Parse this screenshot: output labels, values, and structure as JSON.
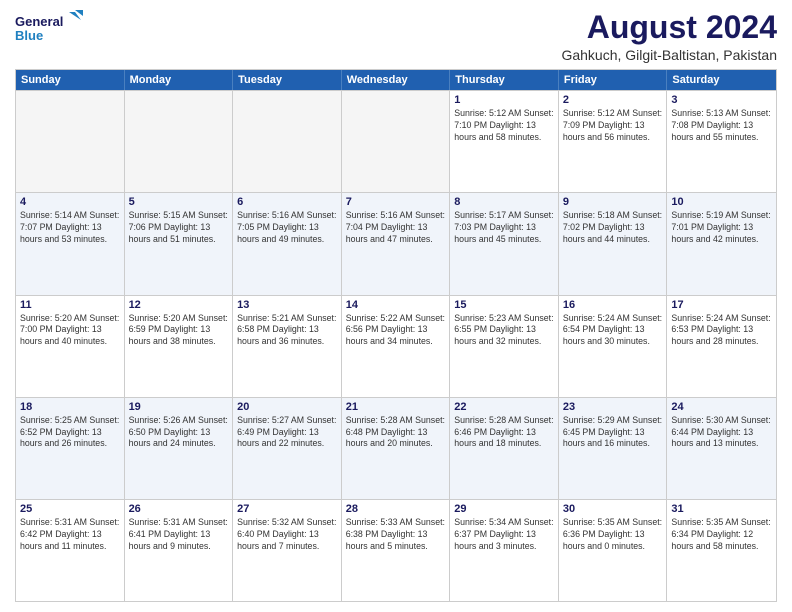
{
  "header": {
    "logo_line1": "General",
    "logo_line2": "Blue",
    "title": "August 2024",
    "subtitle": "Gahkuch, Gilgit-Baltistan, Pakistan"
  },
  "calendar": {
    "days_of_week": [
      "Sunday",
      "Monday",
      "Tuesday",
      "Wednesday",
      "Thursday",
      "Friday",
      "Saturday"
    ],
    "weeks": [
      [
        {
          "day": "",
          "info": "",
          "empty": true
        },
        {
          "day": "",
          "info": "",
          "empty": true
        },
        {
          "day": "",
          "info": "",
          "empty": true
        },
        {
          "day": "",
          "info": "",
          "empty": true
        },
        {
          "day": "1",
          "info": "Sunrise: 5:12 AM\nSunset: 7:10 PM\nDaylight: 13 hours\nand 58 minutes."
        },
        {
          "day": "2",
          "info": "Sunrise: 5:12 AM\nSunset: 7:09 PM\nDaylight: 13 hours\nand 56 minutes."
        },
        {
          "day": "3",
          "info": "Sunrise: 5:13 AM\nSunset: 7:08 PM\nDaylight: 13 hours\nand 55 minutes."
        }
      ],
      [
        {
          "day": "4",
          "info": "Sunrise: 5:14 AM\nSunset: 7:07 PM\nDaylight: 13 hours\nand 53 minutes."
        },
        {
          "day": "5",
          "info": "Sunrise: 5:15 AM\nSunset: 7:06 PM\nDaylight: 13 hours\nand 51 minutes."
        },
        {
          "day": "6",
          "info": "Sunrise: 5:16 AM\nSunset: 7:05 PM\nDaylight: 13 hours\nand 49 minutes."
        },
        {
          "day": "7",
          "info": "Sunrise: 5:16 AM\nSunset: 7:04 PM\nDaylight: 13 hours\nand 47 minutes."
        },
        {
          "day": "8",
          "info": "Sunrise: 5:17 AM\nSunset: 7:03 PM\nDaylight: 13 hours\nand 45 minutes."
        },
        {
          "day": "9",
          "info": "Sunrise: 5:18 AM\nSunset: 7:02 PM\nDaylight: 13 hours\nand 44 minutes."
        },
        {
          "day": "10",
          "info": "Sunrise: 5:19 AM\nSunset: 7:01 PM\nDaylight: 13 hours\nand 42 minutes."
        }
      ],
      [
        {
          "day": "11",
          "info": "Sunrise: 5:20 AM\nSunset: 7:00 PM\nDaylight: 13 hours\nand 40 minutes."
        },
        {
          "day": "12",
          "info": "Sunrise: 5:20 AM\nSunset: 6:59 PM\nDaylight: 13 hours\nand 38 minutes."
        },
        {
          "day": "13",
          "info": "Sunrise: 5:21 AM\nSunset: 6:58 PM\nDaylight: 13 hours\nand 36 minutes."
        },
        {
          "day": "14",
          "info": "Sunrise: 5:22 AM\nSunset: 6:56 PM\nDaylight: 13 hours\nand 34 minutes."
        },
        {
          "day": "15",
          "info": "Sunrise: 5:23 AM\nSunset: 6:55 PM\nDaylight: 13 hours\nand 32 minutes."
        },
        {
          "day": "16",
          "info": "Sunrise: 5:24 AM\nSunset: 6:54 PM\nDaylight: 13 hours\nand 30 minutes."
        },
        {
          "day": "17",
          "info": "Sunrise: 5:24 AM\nSunset: 6:53 PM\nDaylight: 13 hours\nand 28 minutes."
        }
      ],
      [
        {
          "day": "18",
          "info": "Sunrise: 5:25 AM\nSunset: 6:52 PM\nDaylight: 13 hours\nand 26 minutes."
        },
        {
          "day": "19",
          "info": "Sunrise: 5:26 AM\nSunset: 6:50 PM\nDaylight: 13 hours\nand 24 minutes."
        },
        {
          "day": "20",
          "info": "Sunrise: 5:27 AM\nSunset: 6:49 PM\nDaylight: 13 hours\nand 22 minutes."
        },
        {
          "day": "21",
          "info": "Sunrise: 5:28 AM\nSunset: 6:48 PM\nDaylight: 13 hours\nand 20 minutes."
        },
        {
          "day": "22",
          "info": "Sunrise: 5:28 AM\nSunset: 6:46 PM\nDaylight: 13 hours\nand 18 minutes."
        },
        {
          "day": "23",
          "info": "Sunrise: 5:29 AM\nSunset: 6:45 PM\nDaylight: 13 hours\nand 16 minutes."
        },
        {
          "day": "24",
          "info": "Sunrise: 5:30 AM\nSunset: 6:44 PM\nDaylight: 13 hours\nand 13 minutes."
        }
      ],
      [
        {
          "day": "25",
          "info": "Sunrise: 5:31 AM\nSunset: 6:42 PM\nDaylight: 13 hours\nand 11 minutes."
        },
        {
          "day": "26",
          "info": "Sunrise: 5:31 AM\nSunset: 6:41 PM\nDaylight: 13 hours\nand 9 minutes."
        },
        {
          "day": "27",
          "info": "Sunrise: 5:32 AM\nSunset: 6:40 PM\nDaylight: 13 hours\nand 7 minutes."
        },
        {
          "day": "28",
          "info": "Sunrise: 5:33 AM\nSunset: 6:38 PM\nDaylight: 13 hours\nand 5 minutes."
        },
        {
          "day": "29",
          "info": "Sunrise: 5:34 AM\nSunset: 6:37 PM\nDaylight: 13 hours\nand 3 minutes."
        },
        {
          "day": "30",
          "info": "Sunrise: 5:35 AM\nSunset: 6:36 PM\nDaylight: 13 hours\nand 0 minutes."
        },
        {
          "day": "31",
          "info": "Sunrise: 5:35 AM\nSunset: 6:34 PM\nDaylight: 12 hours\nand 58 minutes."
        }
      ]
    ]
  }
}
